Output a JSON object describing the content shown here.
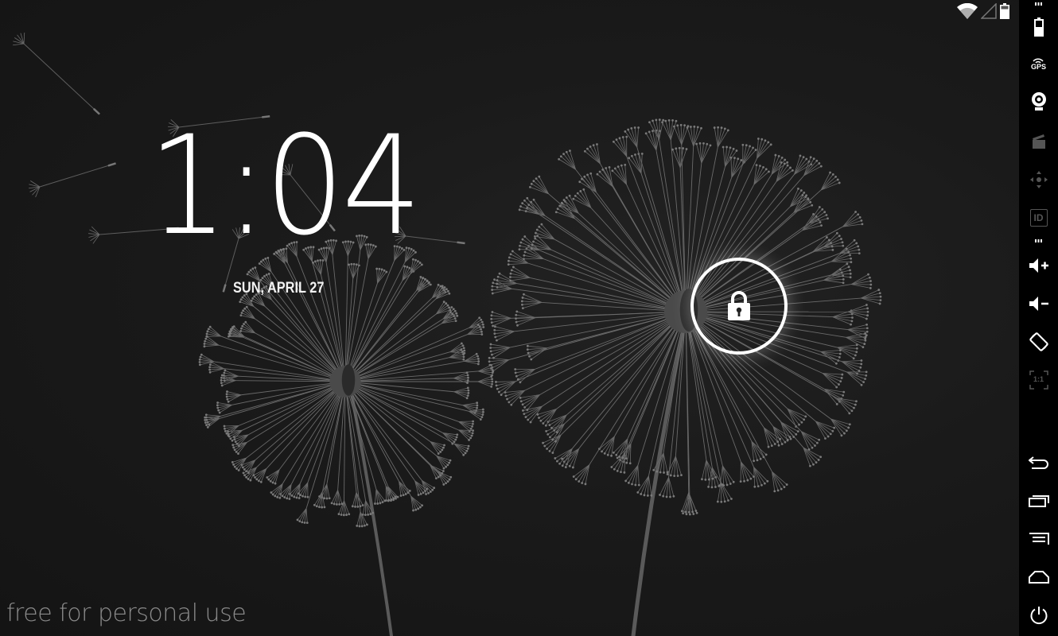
{
  "lockscreen": {
    "time": "1:04",
    "date": "SUN, APRIL 27",
    "watermark": "free for personal use"
  },
  "colors": {
    "background": "#161616",
    "text": "#ffffff",
    "watermark": "#8a8a8a",
    "sidebar": "#000000"
  },
  "status_icons": [
    "wifi-icon",
    "cell-signal-icon",
    "battery-icon"
  ],
  "sidebar": {
    "buttons": [
      "battery-icon",
      "gps-icon",
      "camera-icon",
      "media-icon",
      "dpad-icon",
      "device-id-icon",
      "volume-up-icon",
      "volume-down-icon",
      "rotate-icon",
      "scale-icon",
      "back-icon",
      "recent-apps-icon",
      "menu-icon",
      "home-icon",
      "power-icon"
    ],
    "gps_label": "GPS",
    "id_label": "ID",
    "scale_label": "1:1"
  }
}
